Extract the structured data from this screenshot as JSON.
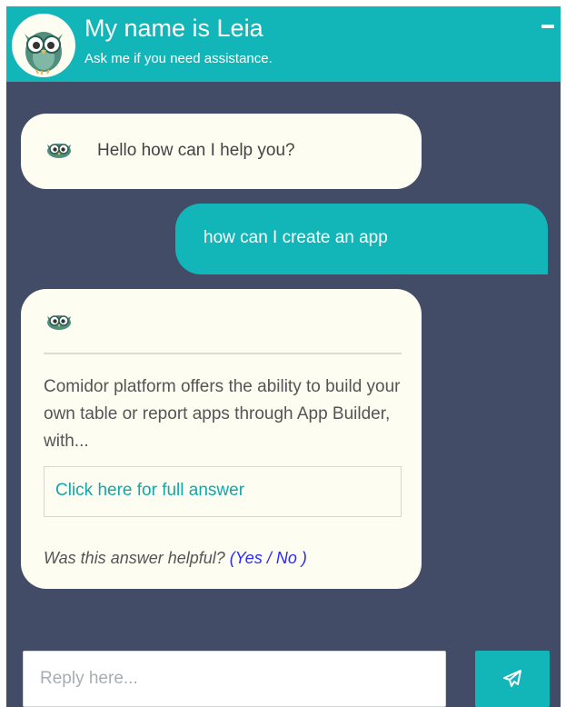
{
  "header": {
    "title": "My name is Leia",
    "subtitle": "Ask me if you need assistance.",
    "minimize_icon": "minus-icon",
    "avatar_icon": "owl-icon"
  },
  "messages": [
    {
      "from": "bot",
      "text": "Hello how can I help you?",
      "icon": "owl-icon"
    },
    {
      "from": "user",
      "text": "how can I create an app"
    },
    {
      "from": "bot",
      "icon": "owl-icon",
      "text": "Comidor platform offers the ability to build your own table or report apps through App Builder, with...",
      "link": "Click here for full answer",
      "feedback": {
        "question": "Was this answer helpful?",
        "open_paren": "(",
        "yes": "Yes",
        "separator": "/",
        "no": "No",
        "close_paren": ")"
      }
    }
  ],
  "composer": {
    "placeholder": "Reply here...",
    "value": "",
    "send_icon": "paper-plane-icon"
  },
  "colors": {
    "accent": "#12b6b9",
    "panel": "#424c66",
    "bubble": "#fdfdf2",
    "link": "#12a7aa",
    "feedback_options": "#2a2aff"
  }
}
